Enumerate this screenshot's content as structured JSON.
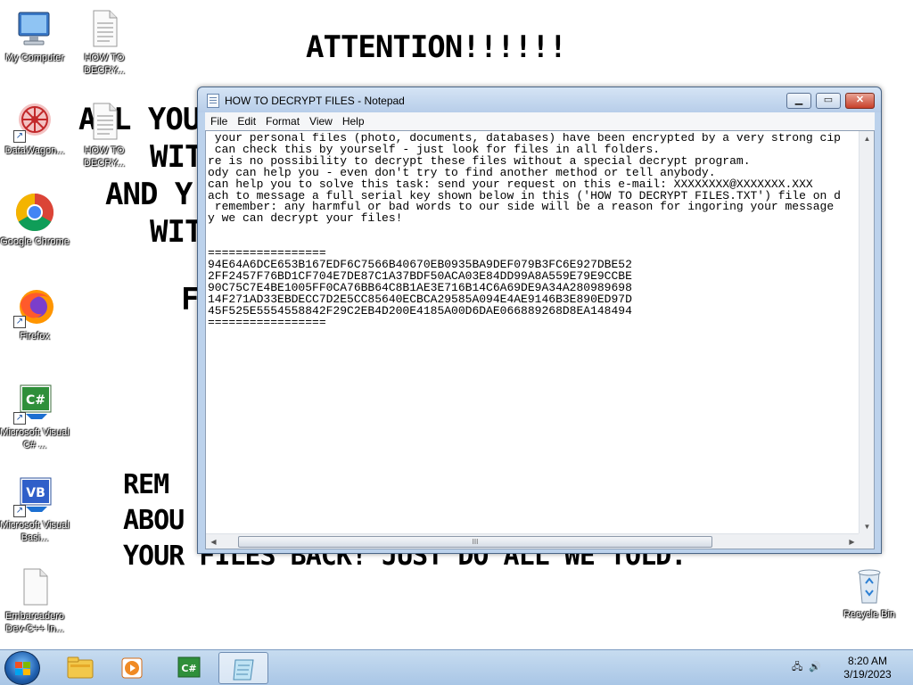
{
  "wallpaper": {
    "heading": "ATTENTION!!!!!!",
    "line1": "ALL YOU",
    "line2": "WIT",
    "line3": "AND Y",
    "line4": "WIT",
    "line5": "F",
    "line6": "REM",
    "line7": "ABOU",
    "line8": "YOUR FILES BACK! JUST DO ALL WE TOLD."
  },
  "desktop_icons": [
    {
      "label": "My Computer",
      "icon": "computer-icon"
    },
    {
      "label": "HOW TO DECRY...",
      "icon": "text-file-icon"
    },
    {
      "label": "DataWagon...",
      "icon": "datawagon-icon"
    },
    {
      "label": "HOW TO DECRY...",
      "icon": "text-file-icon"
    },
    {
      "label": "Google Chrome",
      "icon": "chrome-icon"
    },
    {
      "label": "Firefox",
      "icon": "firefox-icon"
    },
    {
      "label": "Microsoft Visual C# ...",
      "icon": "csharp-icon"
    },
    {
      "label": "Microsoft Visual Basi...",
      "icon": "vb-icon"
    },
    {
      "label": "Embarcadero Dev-C++ In...",
      "icon": "blank-file-icon"
    },
    {
      "label": "Recycle Bin",
      "icon": "recycle-bin-icon"
    }
  ],
  "window": {
    "title": "HOW TO DECRYPT FILES - Notepad",
    "min_label": "▁",
    "max_label": "▭",
    "close_label": "✕",
    "menu": [
      "File",
      "Edit",
      "Format",
      "View",
      "Help"
    ],
    "content": " your personal files (photo, documents, databases) have been encrypted by a very strong cip\n can check this by yourself - just look for files in all folders.\nre is no possibility to decrypt these files without a special decrypt program.\nody can help you - even don't try to find another method or tell anybody.\ncan help you to solve this task: send your request on this e-mail: XXXXXXXX@XXXXXXX.XXX\nach to message a full serial key shown below in this ('HOW TO DECRYPT FILES.TXT') file on d\n remember: any harmful or bad words to our side will be a reason for ingoring your message\ny we can decrypt your files!\n\n\n=================\n94E64A6DCE653B167EDF6C7566B40670EB0935BA9DEF079B3FC6E927DBE52\n2FF2457F76BD1CF704E7DE87C1A37BDF50ACA03E84DD99A8A559E79E9CCBE\n90C75C7E4BE1005FF0CA76BB64C8B1AE3E716B14C6A69DE9A34A280989698\n14F271AD33EBDECC7D2E5CC85640ECBCA29585A094E4AE9146B3E890ED97D\n45F525E5554558842F29C2EB4D200E4185A00D6DAE066889268D8EA148494\n=================",
    "hscroll_thumb": "III"
  },
  "taskbar": {
    "apps": [
      "explorer-icon",
      "media-player-icon",
      "csharp-icon",
      "notepad-icon"
    ],
    "time": "8:20 AM",
    "date": "3/19/2023"
  }
}
